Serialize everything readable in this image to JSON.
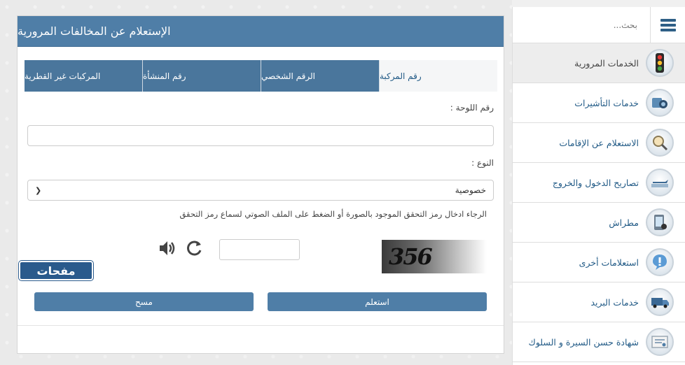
{
  "sidebar": {
    "search_placeholder": "بحث...",
    "items": [
      {
        "label": "الخدمات المرورية",
        "icon": "traffic-light-icon"
      },
      {
        "label": "خدمات التأشيرات",
        "icon": "visa-icon"
      },
      {
        "label": "الاستعلام عن الإقامات",
        "icon": "residency-search-icon"
      },
      {
        "label": "تصاريح الدخول والخروج",
        "icon": "airplane-icon"
      },
      {
        "label": "مطراش",
        "icon": "metrash-icon"
      },
      {
        "label": "استعلامات أخرى",
        "icon": "exclamation-icon"
      },
      {
        "label": "خدمات البريد",
        "icon": "mail-van-icon"
      },
      {
        "label": "شهادة حسن السيرة و السلوك",
        "icon": "certificate-icon"
      }
    ]
  },
  "main": {
    "title": "الإستعلام عن المخالفات المرورية",
    "tabs": [
      "رقم المركبة",
      "الرقم الشخصي",
      "رقم المنشأة",
      "المركبات غير القطرية"
    ],
    "plate_label": "رقم اللوحة :",
    "type_label": "النوع :",
    "type_value": "خصوصية",
    "note": "الرجاء ادخال رمز التحقق الموجود بالصورة أو الضغط على الملف الصوتي لسماع رمز التحقق",
    "captcha_text": "356",
    "submit_label": "استعلم",
    "clear_label": "مسح"
  },
  "watermark": "مفحات",
  "colors": {
    "header_blue": "#4f7ea7",
    "tab_blue": "#4a769c",
    "link_blue": "#215a86"
  }
}
